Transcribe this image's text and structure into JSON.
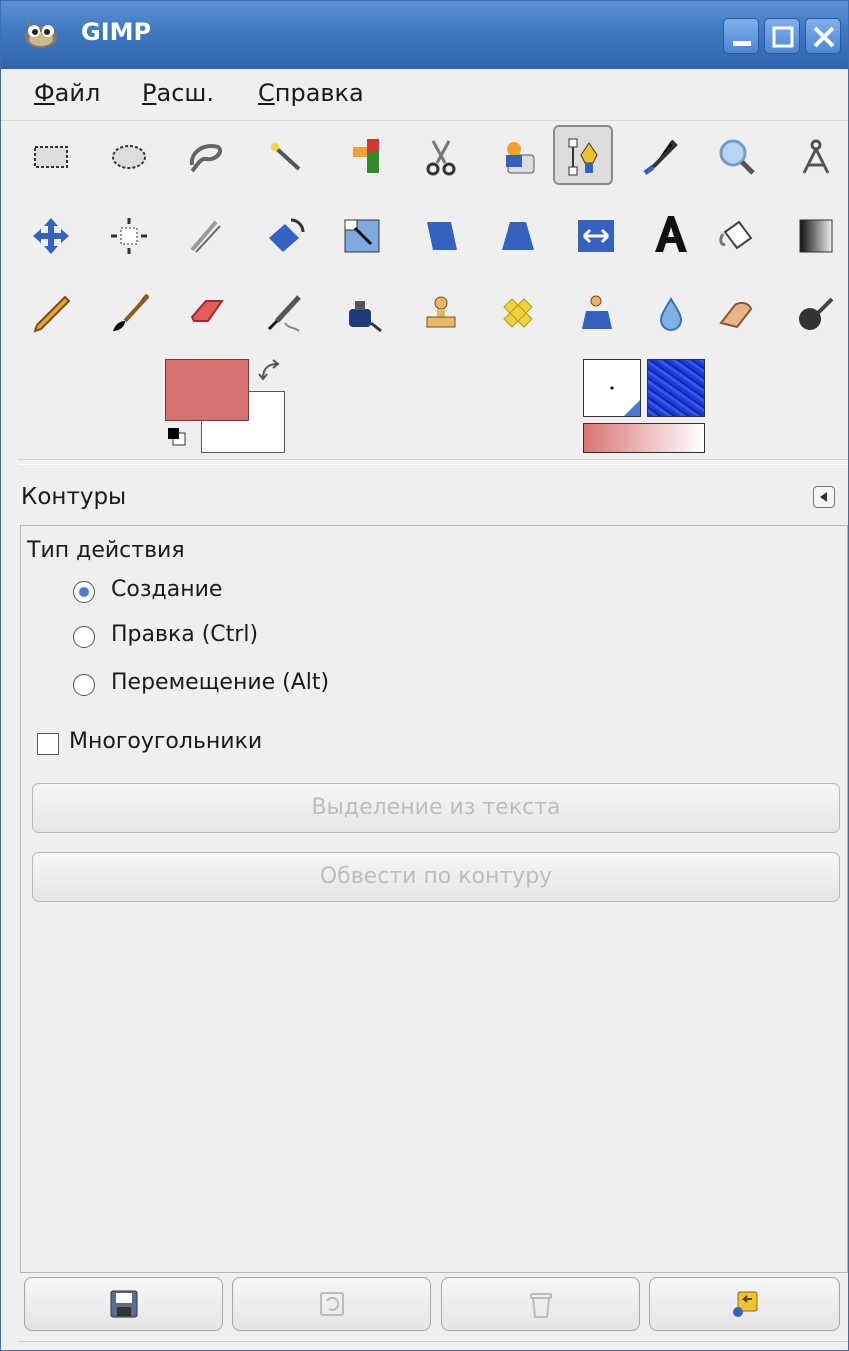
{
  "window": {
    "title": "GIMP",
    "controls": [
      "minimize-icon",
      "maximize-icon",
      "close-icon"
    ],
    "titlebar_color": "#3f78c0"
  },
  "menubar": {
    "items": [
      {
        "mnemonic": "Ф",
        "rest": "айл"
      },
      {
        "mnemonic": "Р",
        "rest": "асш."
      },
      {
        "mnemonic": "С",
        "rest": "правка"
      }
    ]
  },
  "toolbox": {
    "rows": [
      [
        "rect-select-icon",
        "ellipse-select-icon",
        "free-select-icon",
        "fuzzy-select-icon",
        "color-select-icon",
        "scissors-select-icon",
        "foreground-select-icon",
        "paths-tool-icon",
        "color-picker-icon",
        "zoom-icon",
        "measure-icon"
      ],
      [
        "move-icon",
        "align-icon",
        "crop-icon",
        "rotate-icon",
        "scale-icon",
        "shear-icon",
        "perspective-icon",
        "flip-icon",
        "text-icon",
        "bucket-fill-icon",
        "blend-icon"
      ],
      [
        "pencil-icon",
        "paintbrush-icon",
        "eraser-icon",
        "airbrush-icon",
        "ink-icon",
        "clone-icon",
        "heal-icon",
        "perspective-clone-icon",
        "blur-sharpen-icon",
        "smudge-icon",
        "dodge-burn-icon"
      ]
    ],
    "active_tool": "paths-tool-icon"
  },
  "colors": {
    "foreground": "#d77170",
    "background": "#ffffff",
    "pattern": "#1d3bd6"
  },
  "tool_options": {
    "title": "Контуры",
    "edit_mode_label": "Тип действия",
    "modes": [
      {
        "label": "Создание",
        "checked": true
      },
      {
        "label": "Правка (Ctrl)",
        "checked": false
      },
      {
        "label": "Перемещение (Alt)",
        "checked": false
      }
    ],
    "polygonal": {
      "label": "Многоугольники",
      "checked": false
    },
    "selection_from_text": "Выделение из текста",
    "stroke_path": "Обвести по контуру"
  },
  "bottom_buttons": [
    "save-options-icon",
    "restore-options-icon",
    "delete-options-icon",
    "reset-options-icon"
  ]
}
